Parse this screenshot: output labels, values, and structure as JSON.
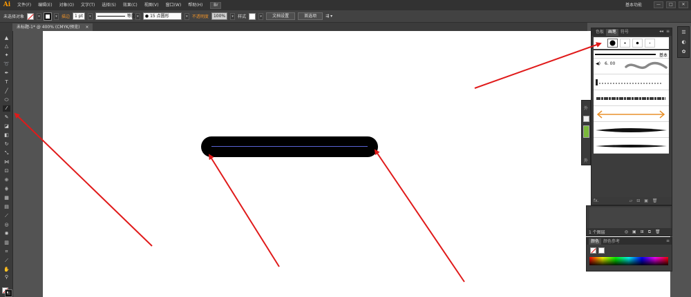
{
  "app": {
    "logo": "Ai",
    "bridge": "Br",
    "workspace": "基本功能",
    "win_controls": [
      "—",
      "□",
      "✕"
    ]
  },
  "menu": [
    "文件(F)",
    "编辑(E)",
    "对象(O)",
    "文字(T)",
    "选择(S)",
    "效果(C)",
    "视图(V)",
    "窗口(W)",
    "帮助(H)"
  ],
  "control_bar": {
    "selection": "未选择对象",
    "stroke_label": "描边",
    "stroke_weight": "1 pt",
    "profile_label": "等比",
    "brush_label": "15 点圆形",
    "opacity_label": "不透明度",
    "opacity_value": "100%",
    "style_label": "样式",
    "doc_setup_btn": "文档设置",
    "prefs_btn": "首选项"
  },
  "document": {
    "tab_label": "未标题-1* @ 400% (CMYK/预览)",
    "close": "×"
  },
  "brushes_panel": {
    "tabs": [
      "色板",
      "画笔",
      "符号"
    ],
    "active_tab": 1,
    "collapse": "◂◂",
    "menu": "≡",
    "basic_label": "基本",
    "size_label": "6. 00",
    "footer": [
      "fx.",
      "▱",
      "⊟",
      "▣",
      "✎",
      "🗑"
    ]
  },
  "layers_panel": {
    "count": "1 个图层",
    "footer_icons": [
      "◎",
      "▣",
      "⊞",
      "⧉",
      "🗑"
    ]
  },
  "color_panel": {
    "tabs": [
      "颜色",
      "颜色参考"
    ],
    "active_tab": 0,
    "menu": "≡"
  },
  "dock": {
    "label_top": "外",
    "label_bottom": "外"
  },
  "right_panel_icons": [
    "☰",
    "◐",
    "✿"
  ],
  "colors": {
    "annotation_arrow": "#e01a1a",
    "path_highlight": "#5a64d8",
    "shape": "#000000"
  }
}
